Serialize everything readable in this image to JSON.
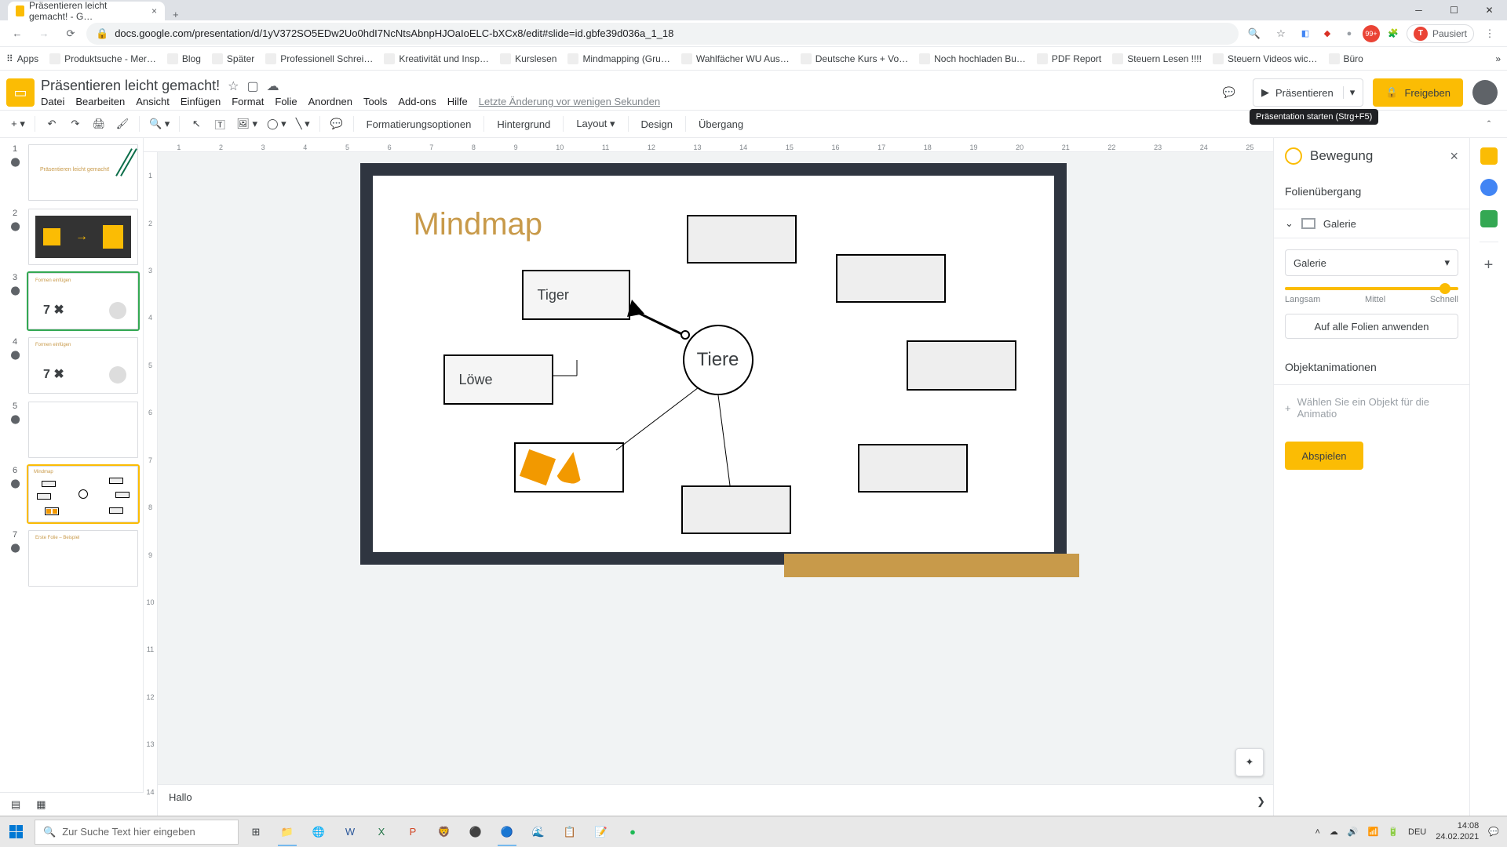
{
  "browser": {
    "tab_title": "Präsentieren leicht gemacht! - G…",
    "url": "docs.google.com/presentation/d/1yV372SO5EDw2Uo0hdI7NcNtsAbnpHJOaIoELC-bXCx8/edit#slide=id.gbfe39d036a_1_18",
    "paused": "Pausiert",
    "bookmarks": [
      "Apps",
      "Produktsuche - Mer…",
      "Blog",
      "Später",
      "Professionell Schrei…",
      "Kreativität und Insp…",
      "Kurslesen",
      "Mindmapping (Gru…",
      "Wahlfächer WU Aus…",
      "Deutsche Kurs + Vo…",
      "Noch hochladen Bu…",
      "PDF Report",
      "Steuern Lesen !!!!",
      "Steuern Videos wic…",
      "Büro"
    ]
  },
  "app": {
    "doc_title": "Präsentieren leicht gemacht!",
    "menu": [
      "Datei",
      "Bearbeiten",
      "Ansicht",
      "Einfügen",
      "Format",
      "Folie",
      "Anordnen",
      "Tools",
      "Add-ons",
      "Hilfe"
    ],
    "last_edit": "Letzte Änderung vor wenigen Sekunden",
    "comments": "Kommentare",
    "present": "Präsentieren",
    "present_tooltip": "Präsentation starten (Strg+F5)",
    "share": "Freigeben"
  },
  "toolbar": {
    "format_options": "Formatierungsoptionen",
    "background": "Hintergrund",
    "layout": "Layout",
    "design": "Design",
    "transition": "Übergang"
  },
  "slides": {
    "thumb3_label": "Formen einfügen",
    "thumb3_text": "7 ✖",
    "thumb7_label": "Erste Folie – Beispiel"
  },
  "canvas": {
    "title": "Mindmap",
    "box_tiger": "Tiger",
    "box_lowe": "Löwe",
    "circle": "Tiere",
    "speaker_notes": "Hallo"
  },
  "motion": {
    "title": "Bewegung",
    "section_transition": "Folienübergang",
    "gallery": "Galerie",
    "select_value": "Galerie",
    "speed_slow": "Langsam",
    "speed_mid": "Mittel",
    "speed_fast": "Schnell",
    "apply_all": "Auf alle Folien anwenden",
    "section_obj": "Objektanimationen",
    "obj_hint": "Wählen Sie ein Objekt für die Animatio",
    "play": "Abspielen"
  },
  "taskbar": {
    "search_placeholder": "Zur Suche Text hier eingeben",
    "lang": "DEU",
    "time": "14:08",
    "date": "24.02.2021"
  }
}
